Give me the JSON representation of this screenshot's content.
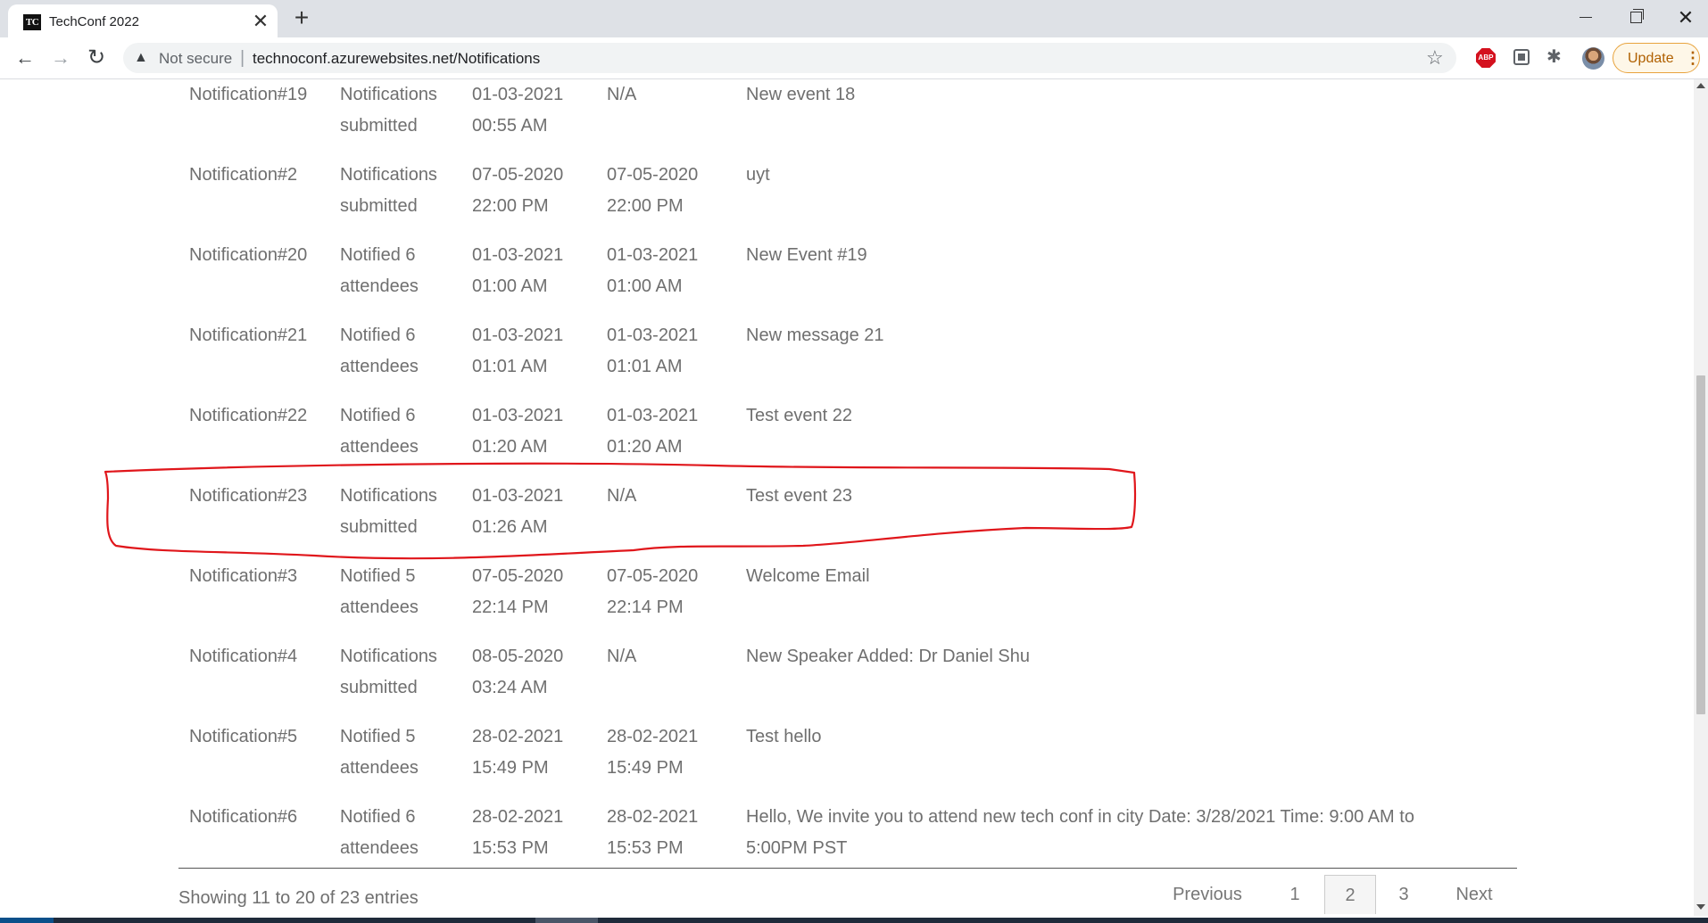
{
  "browser": {
    "tab": {
      "favicon_text": "TC",
      "title": "TechConf 2022",
      "close_glyph": "✕"
    },
    "new_tab_glyph": "+",
    "window": {
      "close_glyph": "✕"
    },
    "nav": {
      "back_glyph": "←",
      "forward_glyph": "→",
      "reload_glyph": "↻"
    },
    "address": {
      "warning_glyph": "▲",
      "security_label": "Not secure",
      "separator": "|",
      "url": "technoconf.azurewebsites.net/Notifications",
      "bookmark_glyph": "☆"
    },
    "extensions": {
      "abp_label": "ABP",
      "puzzle_glyph": "✱"
    },
    "update_button": {
      "label": "Update",
      "menu_glyph": "⋮"
    }
  },
  "notifications": {
    "rows": [
      {
        "name": "Notification#19",
        "status": [
          "Notifications",
          "submitted"
        ],
        "submitted": [
          "01-03-2021",
          "00:55 AM"
        ],
        "completed": [
          "N/A",
          ""
        ],
        "subject": [
          "New event 18",
          ""
        ]
      },
      {
        "name": "Notification#2",
        "status": [
          "Notifications",
          "submitted"
        ],
        "submitted": [
          "07-05-2020",
          "22:00 PM"
        ],
        "completed": [
          "07-05-2020",
          "22:00 PM"
        ],
        "subject": [
          "uyt",
          ""
        ]
      },
      {
        "name": "Notification#20",
        "status": [
          "Notified 6",
          "attendees"
        ],
        "submitted": [
          "01-03-2021",
          "01:00 AM"
        ],
        "completed": [
          "01-03-2021",
          "01:00 AM"
        ],
        "subject": [
          "New Event #19",
          ""
        ]
      },
      {
        "name": "Notification#21",
        "status": [
          "Notified 6",
          "attendees"
        ],
        "submitted": [
          "01-03-2021",
          "01:01 AM"
        ],
        "completed": [
          "01-03-2021",
          "01:01 AM"
        ],
        "subject": [
          "New message 21",
          ""
        ]
      },
      {
        "name": "Notification#22",
        "status": [
          "Notified 6",
          "attendees"
        ],
        "submitted": [
          "01-03-2021",
          "01:20 AM"
        ],
        "completed": [
          "01-03-2021",
          "01:20 AM"
        ],
        "subject": [
          "Test event 22",
          ""
        ]
      },
      {
        "name": "Notification#23",
        "status": [
          "Notifications",
          "submitted"
        ],
        "submitted": [
          "01-03-2021",
          "01:26 AM"
        ],
        "completed": [
          "N/A",
          ""
        ],
        "subject": [
          "Test event 23",
          ""
        ]
      },
      {
        "name": "Notification#3",
        "status": [
          "Notified 5",
          "attendees"
        ],
        "submitted": [
          "07-05-2020",
          "22:14 PM"
        ],
        "completed": [
          "07-05-2020",
          "22:14 PM"
        ],
        "subject": [
          "Welcome Email",
          ""
        ]
      },
      {
        "name": "Notification#4",
        "status": [
          "Notifications",
          "submitted"
        ],
        "submitted": [
          "08-05-2020",
          "03:24 AM"
        ],
        "completed": [
          "N/A",
          ""
        ],
        "subject": [
          "New Speaker Added: Dr Daniel Shu",
          ""
        ]
      },
      {
        "name": "Notification#5",
        "status": [
          "Notified 5",
          "attendees"
        ],
        "submitted": [
          "28-02-2021",
          "15:49 PM"
        ],
        "completed": [
          "28-02-2021",
          "15:49 PM"
        ],
        "subject": [
          "Test hello",
          ""
        ]
      },
      {
        "name": "Notification#6",
        "status": [
          "Notified 6",
          "attendees"
        ],
        "submitted": [
          "28-02-2021",
          "15:53 PM"
        ],
        "completed": [
          "28-02-2021",
          "15:53 PM"
        ],
        "subject": [
          "Hello, We invite you to attend new tech conf in city Date: 3/28/2021 Time: 9:00 AM to",
          "5:00PM PST"
        ]
      }
    ],
    "info": "Showing 11 to 20 of 23 entries",
    "pagination": {
      "previous": "Previous",
      "pages": [
        "1",
        "2",
        "3"
      ],
      "current": "2",
      "next": "Next"
    }
  },
  "annotation": {
    "color": "#e0161b",
    "highlighted_row": "Notification#23"
  }
}
